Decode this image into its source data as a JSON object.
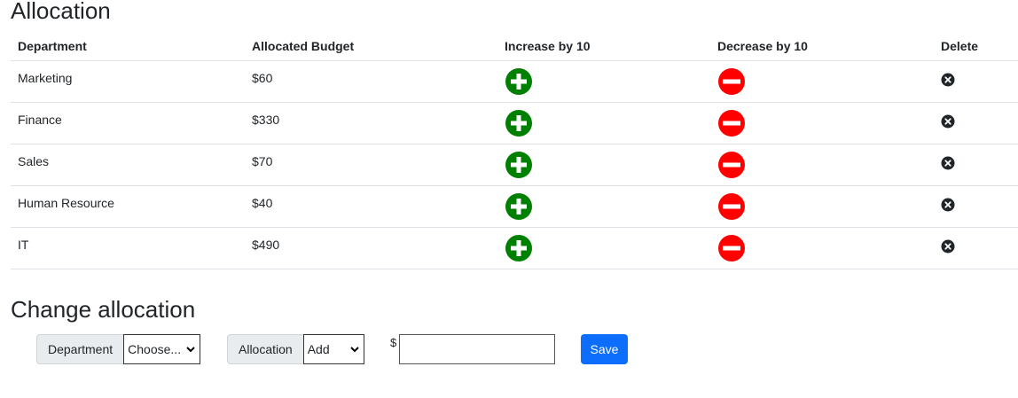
{
  "titles": {
    "allocation": "Allocation",
    "change": "Change allocation"
  },
  "table": {
    "headers": [
      "Department",
      "Allocated Budget",
      "Increase by 10",
      "Decrease by 10",
      "Delete"
    ],
    "rows": [
      {
        "department": "Marketing",
        "budget": "$60"
      },
      {
        "department": "Finance",
        "budget": "$330"
      },
      {
        "department": "Sales",
        "budget": "$70"
      },
      {
        "department": "Human Resource",
        "budget": "$40"
      },
      {
        "department": "IT",
        "budget": "$490"
      }
    ]
  },
  "icons": {
    "increase": "plus-circle-icon",
    "decrease": "minus-circle-icon",
    "delete": "x-circle-icon"
  },
  "colors": {
    "increase": "#008000",
    "decrease": "#ff0000",
    "save": "#0d6efd"
  },
  "form": {
    "department_label": "Department",
    "department_value": "Choose...",
    "allocation_label": "Allocation",
    "allocation_value": "Add",
    "currency": "$",
    "amount_value": "",
    "save_label": "Save"
  }
}
